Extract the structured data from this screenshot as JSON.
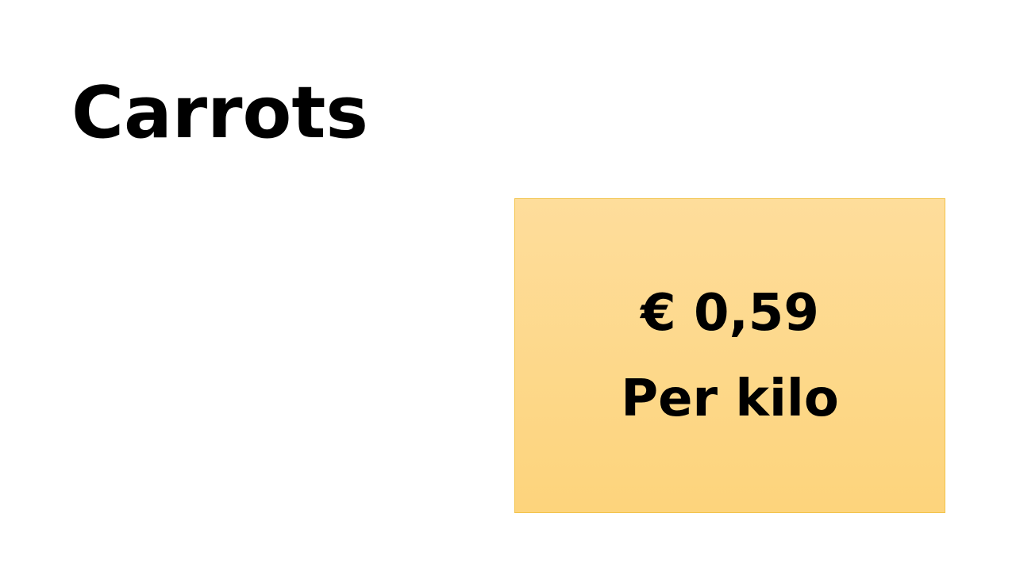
{
  "slide": {
    "title": "Carrots",
    "price_box": {
      "price": "€ 0,59",
      "unit": "Per kilo"
    }
  },
  "colors": {
    "background": "#ffffff",
    "box_fill": "#fdd88a",
    "box_border": "#f2c34a",
    "text": "#000000"
  }
}
